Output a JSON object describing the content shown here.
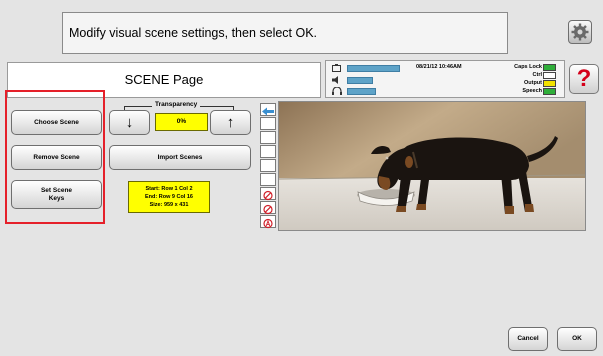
{
  "prompt": {
    "text": "Modify visual scene settings, then select OK."
  },
  "page": {
    "title": "SCENE Page"
  },
  "status": {
    "datetime": "08/21/12 10:46AM",
    "levels": {
      "battery": 0.85,
      "volume": 0.4,
      "headphone": 0.45
    },
    "indicators": [
      {
        "label": "Caps Lock",
        "color": "#2fae3a"
      },
      {
        "label": "Ctrl",
        "color": "#ffffff"
      },
      {
        "label": "Output",
        "color": "#f2e200"
      },
      {
        "label": "Speech",
        "color": "#2fae3a"
      }
    ]
  },
  "help": {
    "label": "?"
  },
  "scene_buttons": {
    "choose": "Choose Scene",
    "remove": "Remove Scene",
    "set_keys_line1": "Set Scene",
    "set_keys_line2": "Keys"
  },
  "transparency": {
    "label": "Transparency",
    "value": "0%",
    "down_arrow": "↓",
    "up_arrow": "↑"
  },
  "import": {
    "label": "Import Scenes"
  },
  "scene_info": {
    "start": "Start: Row 1 Col 2",
    "end": "End: Row 9 Col 16",
    "size": "Size: 959 x 431"
  },
  "footer": {
    "cancel": "Cancel",
    "ok": "OK"
  },
  "colors": {
    "highlight_frame": "#e5202a",
    "value_background": "#ffff00",
    "help_mark": "#d4001a"
  }
}
